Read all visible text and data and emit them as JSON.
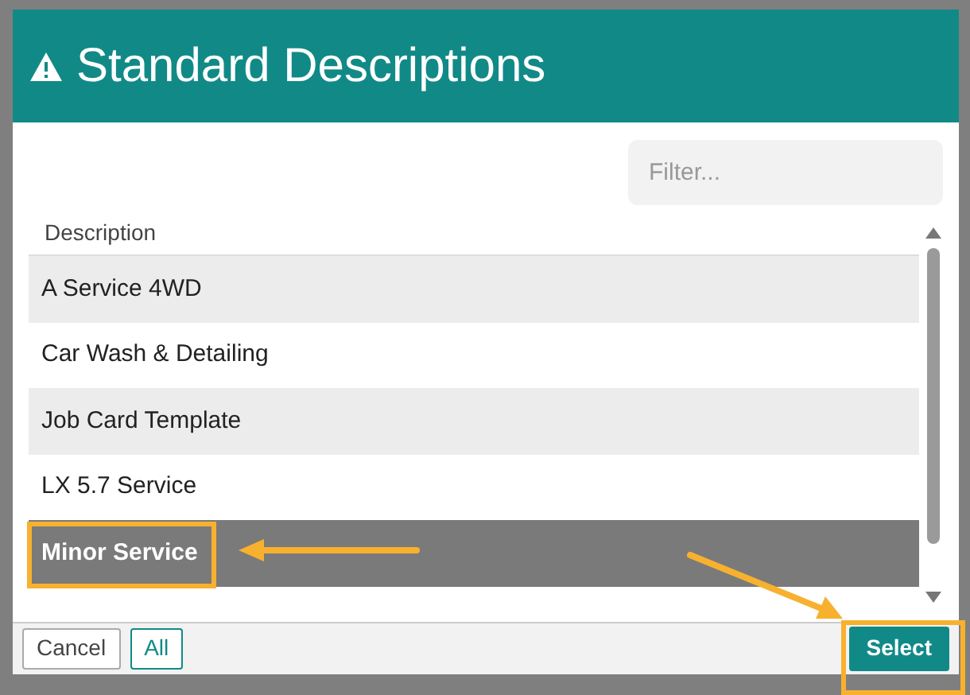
{
  "dialog": {
    "title": "Standard Descriptions"
  },
  "filter": {
    "placeholder": "Filter..."
  },
  "table": {
    "columns": [
      {
        "label": "Description"
      }
    ],
    "rows": [
      {
        "description": "A Service 4WD",
        "selected": false
      },
      {
        "description": "Car Wash & Detailing",
        "selected": false
      },
      {
        "description": "Job Card Template",
        "selected": false
      },
      {
        "description": "LX 5.7 Service",
        "selected": false
      },
      {
        "description": "Minor Service",
        "selected": true
      }
    ]
  },
  "footer": {
    "buttons": [
      {
        "label": "Cancel",
        "kind": "cancel"
      },
      {
        "label": "All",
        "kind": "all"
      },
      {
        "label": "Select",
        "kind": "primary"
      }
    ]
  }
}
